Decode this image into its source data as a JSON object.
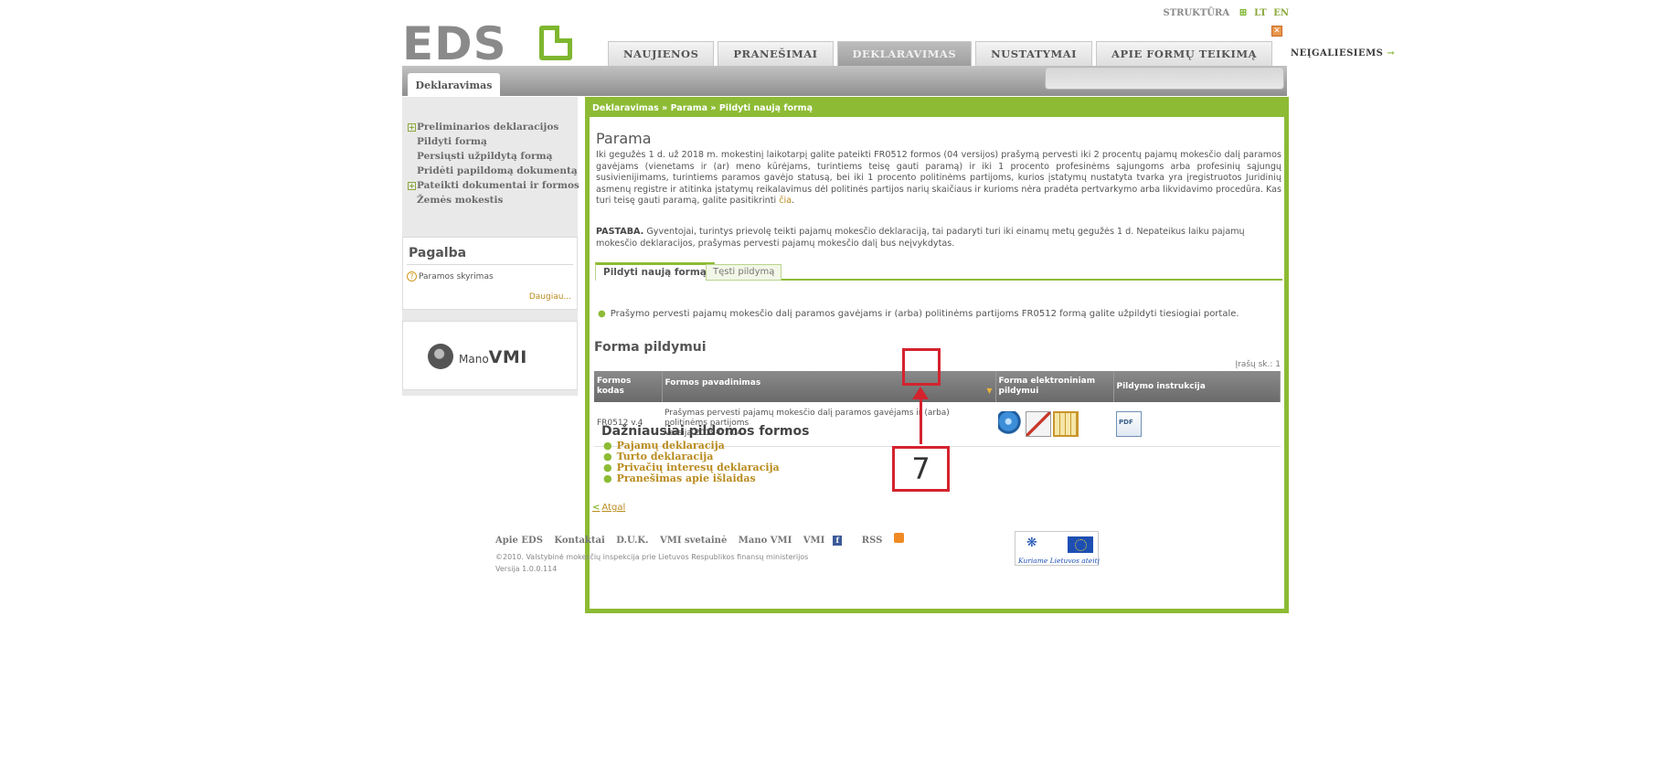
{
  "header": {
    "logo_text": "EDS",
    "struktura": "STRUKTŪRA",
    "lang_lt": "LT",
    "lang_en": "EN",
    "close_glyph": "✕",
    "nav": [
      "NAUJIENOS",
      "PRANEŠIMAI",
      "DEKLARAVIMAS",
      "NUSTATYMAI",
      "APIE FORMŲ TEIKIMĄ"
    ],
    "disabled_link": "NEĮGALIESIEMS",
    "disabled_arrow": "→",
    "subtab": "Deklaravimas"
  },
  "sidebar": {
    "items": [
      {
        "label": "Preliminarios deklaracijos",
        "plus": "+"
      },
      {
        "label": "Pildyti formą"
      },
      {
        "label": "Persiųsti užpildytą formą"
      },
      {
        "label": "Pridėti papildomą dokumentą"
      },
      {
        "label": "Pateikti dokumentai ir formos",
        "plus": "+"
      },
      {
        "label": "Žemės mokestis"
      }
    ],
    "help_title": "Pagalba",
    "help_item": "Paramos skyrimas",
    "help_more": "Daugiau...",
    "mano_prefix": "Mano",
    "mano_brand": "VMI"
  },
  "main": {
    "breadcrumb": "Deklaravimas » Parama » Pildyti naują formą",
    "title": "Parama",
    "paragraph": "Iki gegužės 1 d. už 2018 m. mokestinį laikotarpį galite pateikti FR0512 formos (04 versijos) prašymą pervesti iki 2 procentų pajamų mokesčio dalį paramos gavėjams (vienetams ir (ar) meno kūrėjams, turintiems teisę gauti paramą) ir iki 1 procento profesinėms sąjungoms arba profesinių sąjungų susivienijimams, turintiems paramos gavėjo statusą, bei iki 1 procento politinėms partijoms, kurios įstatymų nustatyta tvarka yra įregistruotos Juridinių asmenų registre ir atitinka įstatymų reikalavimus dėl politinės partijos narių skaičiaus ir kurioms nėra pradėta pertvarkymo arba likvidavimo procedūra. Kas turi teisę gauti paramą, galite pasitikrinti ",
    "paragraph_link": "čia",
    "note_label": "PASTABA.",
    "note_text": " Gyventojai, turintys prievolę teikti pajamų mokesčio deklaraciją, tai padaryti turi iki einamų metų gegužės 1 d. Nepateikus laiku pajamų mokesčio deklaracijos, prašymas pervesti pajamų mokesčio dalį bus neįvykdytas.",
    "tab_new": "Pildyti naują formą",
    "tab_continue": "Tęsti pildymą",
    "bullet": "Prašymo pervesti pajamų mokesčio dalį paramos gavėjams ir (arba) politinėms partijoms FR0512 formą galite užpildyti tiesiogiai portale.",
    "forma_title": "Forma pildymui",
    "count": "Įrašų sk.: 1",
    "table": {
      "headers": [
        "Formos kodas",
        "Formos pavadinimas",
        "Forma elektroniniam pildymui",
        "Pildymo instrukcija"
      ],
      "sort_glyph": "▼",
      "row": {
        "code": "FR0512 v.4",
        "name": "Prašymas pervesti pajamų mokesčio dalį paramos gavėjams ir (arba) politinėms partijoms",
        "version": "Versija 2019-01-04"
      },
      "icons": [
        "globe-fill-online-icon",
        "edit-form-icon",
        "calculator-form-icon",
        "pdf-instruction-icon"
      ]
    },
    "annotation_number": "7",
    "freq_title": "Dažniausiai pildomos formos",
    "freq_items": [
      "Pajamų deklaracija",
      "Turto deklaracija",
      "Privačių interesų deklaracija",
      "Pranešimas apie išlaidas"
    ],
    "back": "Atgal",
    "back_glyph": "<"
  },
  "footer": {
    "links": [
      "Apie EDS",
      "Kontaktai",
      "D.U.K.",
      "VMI svetainė",
      "Mano VMI",
      "VMI",
      "RSS"
    ],
    "copyright": "©2010. Valstybinė mokesčių inspekcija prie Lietuvos Respublikos finansų ministerijos",
    "version": "Versija 1.0.0.114",
    "eu_slogan": "Kuriame Lietuvos ateitį"
  },
  "colors": {
    "accent_green": "#8dbb34",
    "link_gold": "#b98b1e",
    "annotation_red": "#d4232e"
  }
}
